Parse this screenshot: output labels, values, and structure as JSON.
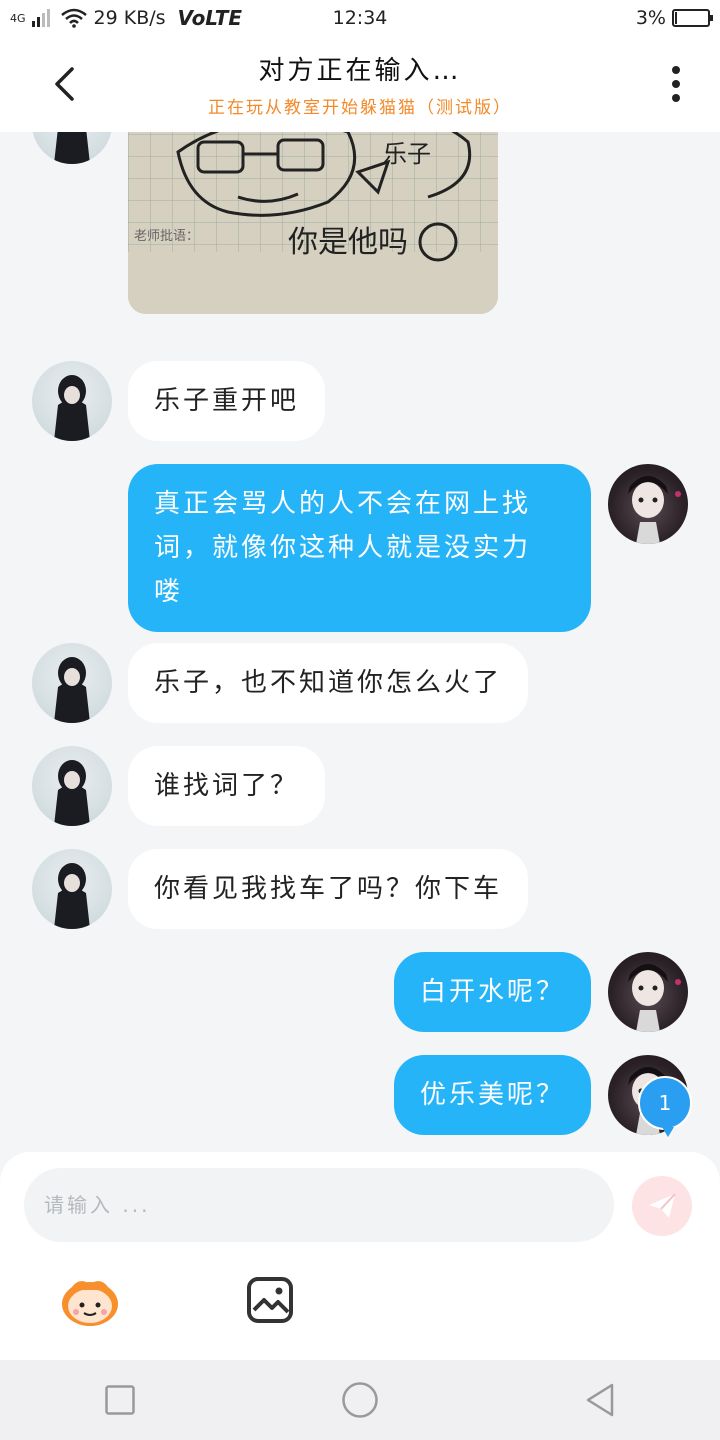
{
  "status_bar": {
    "network": "4G",
    "speed": "29 KB/s",
    "volte": "VoLTE",
    "time": "12:34",
    "battery": "3%",
    "battery_level": 0.03
  },
  "header": {
    "title": "对方正在输入…",
    "subtitle": "正在玩从教室开始躲猫猫（测试版）"
  },
  "image_message": {
    "caption": "老师批语：",
    "drawn_text_1": "乐子",
    "drawn_text_2": "你是他吗"
  },
  "messages": [
    {
      "from": "other",
      "text": "乐子重开吧"
    },
    {
      "from": "me",
      "text": "真正会骂人的人不会在网上找\n词，就像你这种人就是没实力\n喽"
    },
    {
      "from": "other",
      "text": "乐子，也不知道你怎么火了"
    },
    {
      "from": "other",
      "text": "谁找词了？"
    },
    {
      "from": "other",
      "text": "你看见我找车了吗？你下车"
    },
    {
      "from": "me",
      "text": "白开水呢？"
    },
    {
      "from": "me",
      "text": "优乐美呢？"
    }
  ],
  "unread_badge": "1",
  "input": {
    "placeholder": "请输入 ..."
  },
  "colors": {
    "my_bubble": "#26b4f8",
    "subtitle": "#f28a2a",
    "send_button_bg": "#fde3e3",
    "badge": "#2a9ef0"
  },
  "icons": [
    "back-arrow-icon",
    "more-icon",
    "send-icon",
    "sticker-icon",
    "image-icon",
    "square-nav-icon",
    "home-circle-icon",
    "back-triangle-icon"
  ]
}
